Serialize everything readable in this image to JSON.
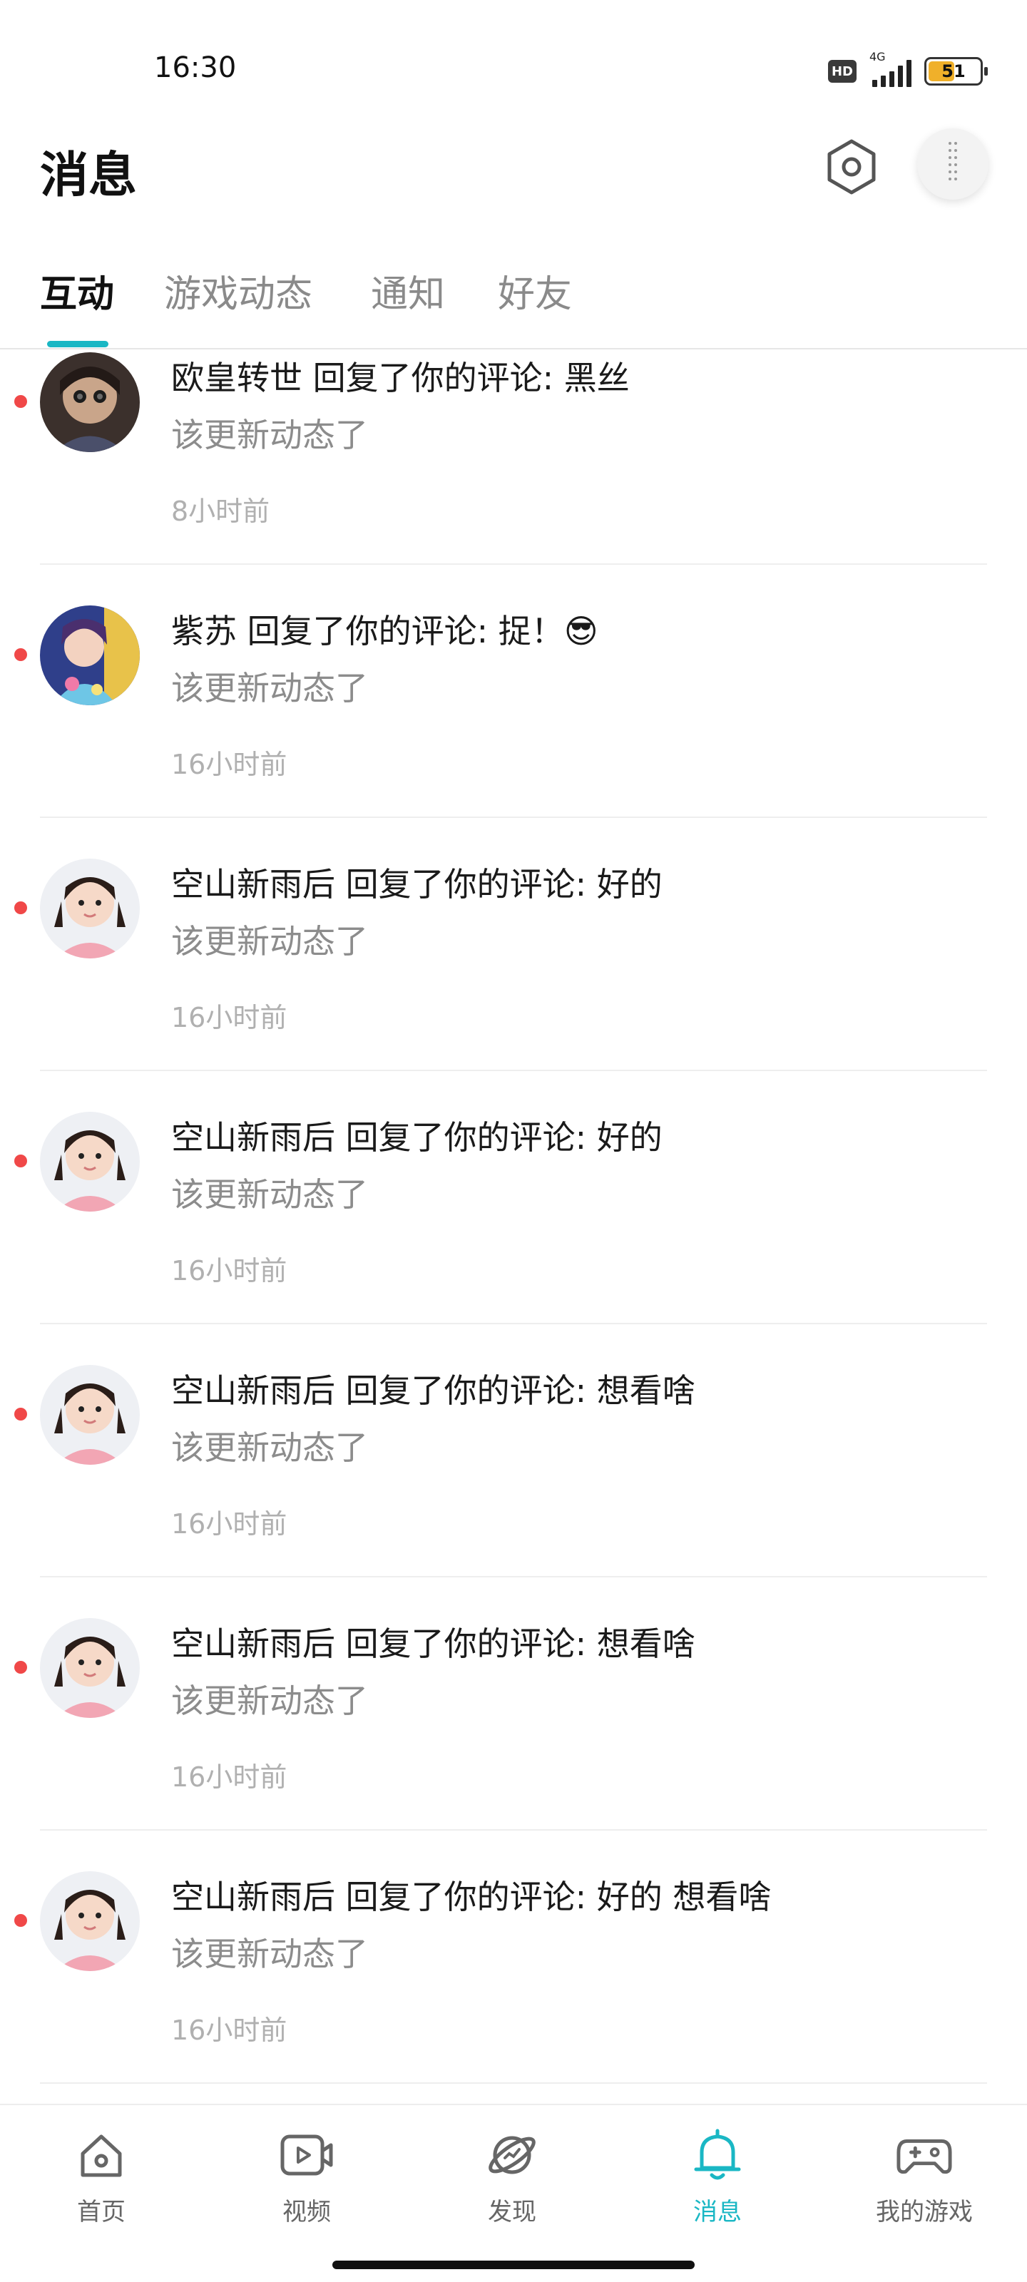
{
  "status_bar": {
    "time": "16:30",
    "hd": "HD",
    "network": "4G",
    "battery": "51",
    "battery_level": 0.51
  },
  "header": {
    "title": "消息",
    "settings_icon": "hexagon-settings-icon",
    "more_icon": "vertical-dots-icon"
  },
  "tabs": [
    {
      "label": "互动",
      "active": true
    },
    {
      "label": "游戏动态",
      "active": false
    },
    {
      "label": "通知",
      "active": false
    },
    {
      "label": "好友",
      "active": false
    }
  ],
  "colors": {
    "accent": "#1ab7c4",
    "unread_dot": "#f04848",
    "secondary_text": "#8c8c8c",
    "time_text": "#b0b0b0"
  },
  "messages": [
    {
      "title": "欧皇转世 回复了你的评论: 黑丝",
      "subtitle": "该更新动态了",
      "time": "8小时前",
      "unread": true,
      "avatar": "dark-avatar"
    },
    {
      "title": "紫苏 回复了你的评论: 捉！😎",
      "subtitle": "该更新动态了",
      "time": "16小时前",
      "unread": true,
      "avatar": "colorful-avatar"
    },
    {
      "title": "空山新雨后 回复了你的评论: 好的",
      "subtitle": "该更新动态了",
      "time": "16小时前",
      "unread": true,
      "avatar": "child-avatar"
    },
    {
      "title": "空山新雨后 回复了你的评论: 好的",
      "subtitle": "该更新动态了",
      "time": "16小时前",
      "unread": true,
      "avatar": "child-avatar"
    },
    {
      "title": "空山新雨后 回复了你的评论: 想看啥",
      "subtitle": "该更新动态了",
      "time": "16小时前",
      "unread": true,
      "avatar": "child-avatar"
    },
    {
      "title": "空山新雨后 回复了你的评论: 想看啥",
      "subtitle": "该更新动态了",
      "time": "16小时前",
      "unread": true,
      "avatar": "child-avatar"
    },
    {
      "title": "空山新雨后 回复了你的评论: 好的 想看啥",
      "subtitle": "该更新动态了",
      "time": "16小时前",
      "unread": true,
      "avatar": "child-avatar"
    }
  ],
  "bottom_nav": [
    {
      "label": "首页",
      "icon": "home-icon",
      "active": false
    },
    {
      "label": "视频",
      "icon": "video-icon",
      "active": false
    },
    {
      "label": "发现",
      "icon": "planet-icon",
      "active": false
    },
    {
      "label": "消息",
      "icon": "bell-icon",
      "active": true
    },
    {
      "label": "我的游戏",
      "icon": "gamepad-icon",
      "active": false
    }
  ]
}
